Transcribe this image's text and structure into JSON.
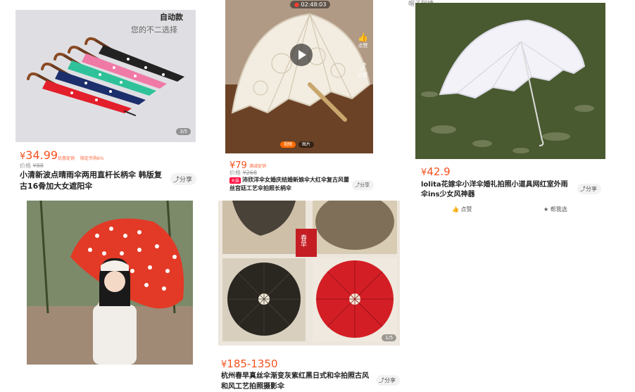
{
  "cards": [
    {
      "overlay_top": "自动款",
      "overlay_sub": "您的不二选择",
      "pager": "3/5",
      "price": "34.99",
      "currency": "¥",
      "price_prefix": "价格",
      "orig_price": "¥88",
      "tag1": "优惠促销",
      "tag2": "限定币购6%",
      "title": "小清新波点晴雨伞两用直杆长柄伞 韩版复古16骨加大女遮阳伞",
      "share": "分享"
    },
    {
      "video_time": "02:48:03",
      "side_label_1": "点赞",
      "side_label_2": "分享",
      "btn_video": "视频",
      "btn_image": "图片",
      "price": "79",
      "currency": "¥",
      "tag": "满减促销",
      "price_prefix": "价格",
      "orig_price": "¥268",
      "badge": "天猫",
      "title": "沛欣洋伞女婚庆结婚新娘伞大红伞复古风蕾丝宫廷工艺伞拍照长柄伞",
      "share": "分享"
    },
    {
      "watermark": "帽子阿姨",
      "price": "42.9",
      "currency": "¥",
      "title": "lolita花嫁伞小洋伞婚礼拍照小道具网红室外雨伞ins少女风神器",
      "share": "分享",
      "like": "点赞",
      "help": "帮我选"
    },
    {
      "pager": "1/5",
      "price": "185-1350",
      "currency": "¥",
      "title": "杭州春早真丝伞渐变灰紫红黑日式和伞拍照古风和风工艺拍照摄影伞",
      "share": "分享",
      "seal_text": "春早"
    }
  ],
  "colors": {
    "price": "#f4511e",
    "accent": "#ff6a3d"
  },
  "icons": [
    "share-icon",
    "play-icon",
    "heart-icon",
    "thumbs-up-icon",
    "help-icon"
  ]
}
